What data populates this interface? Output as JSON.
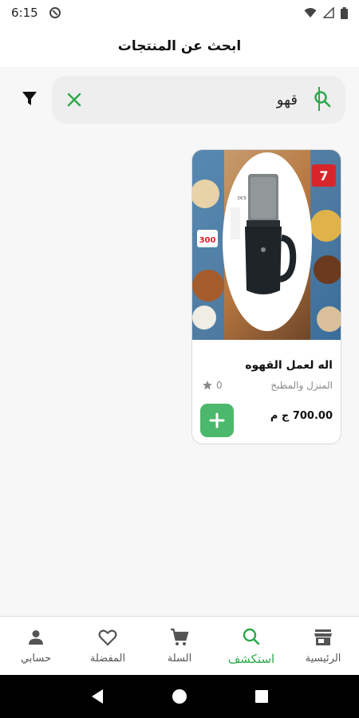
{
  "status_bar": {
    "time": "6:15"
  },
  "header": {
    "title": "ابحث عن المنتجات"
  },
  "search": {
    "value": "قهو",
    "placeholder": ""
  },
  "product": {
    "name": "اله لعمل القهوه",
    "category": "المنزل والمطبخ",
    "rating": "0",
    "price": "700.00 ج م",
    "image_labels": {
      "discount": "7",
      "badge": "300"
    }
  },
  "bottom_nav": {
    "items": [
      {
        "label": "حسابي",
        "icon": "person-icon"
      },
      {
        "label": "المفضلة",
        "icon": "heart-icon"
      },
      {
        "label": "السلة",
        "icon": "cart-icon"
      },
      {
        "label": "استكشف",
        "icon": "search-icon"
      },
      {
        "label": "الرئيسية",
        "icon": "store-icon"
      }
    ],
    "active_index": 3
  },
  "colors": {
    "accent": "#2aa84a",
    "add_button": "#4cb86b"
  }
}
